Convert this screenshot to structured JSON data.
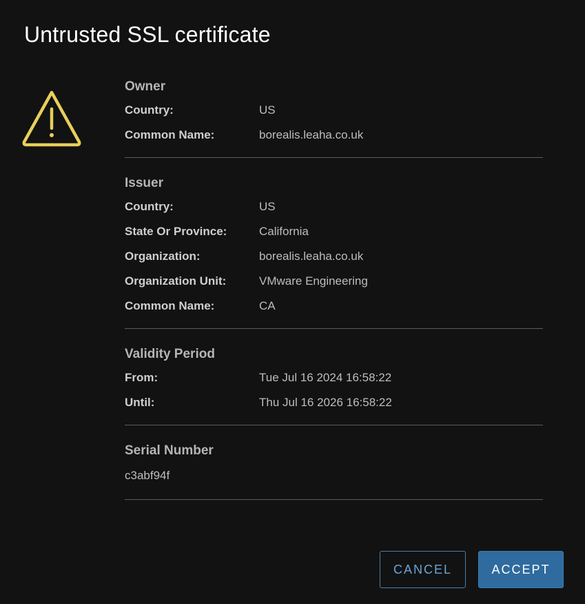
{
  "dialog": {
    "title": "Untrusted SSL certificate",
    "icon": "warning-triangle-icon",
    "accent_color": "#e8cf5a"
  },
  "owner": {
    "title": "Owner",
    "rows": [
      {
        "label": "Country:",
        "value": "US"
      },
      {
        "label": "Common Name:",
        "value": "borealis.leaha.co.uk"
      }
    ]
  },
  "issuer": {
    "title": "Issuer",
    "rows": [
      {
        "label": "Country:",
        "value": "US"
      },
      {
        "label": "State Or Province:",
        "value": "California"
      },
      {
        "label": "Organization:",
        "value": "borealis.leaha.co.uk"
      },
      {
        "label": "Organization Unit:",
        "value": "VMware Engineering"
      },
      {
        "label": "Common Name:",
        "value": "CA"
      }
    ]
  },
  "validity": {
    "title": "Validity Period",
    "rows": [
      {
        "label": "From:",
        "value": "Tue Jul 16 2024 16:58:22"
      },
      {
        "label": "Until:",
        "value": "Thu Jul 16 2026 16:58:22"
      }
    ]
  },
  "serial": {
    "title": "Serial Number",
    "value": "c3abf94f"
  },
  "buttons": {
    "cancel_label": "CANCEL",
    "accept_label": "ACCEPT",
    "primary_color": "#2f6b9e"
  }
}
